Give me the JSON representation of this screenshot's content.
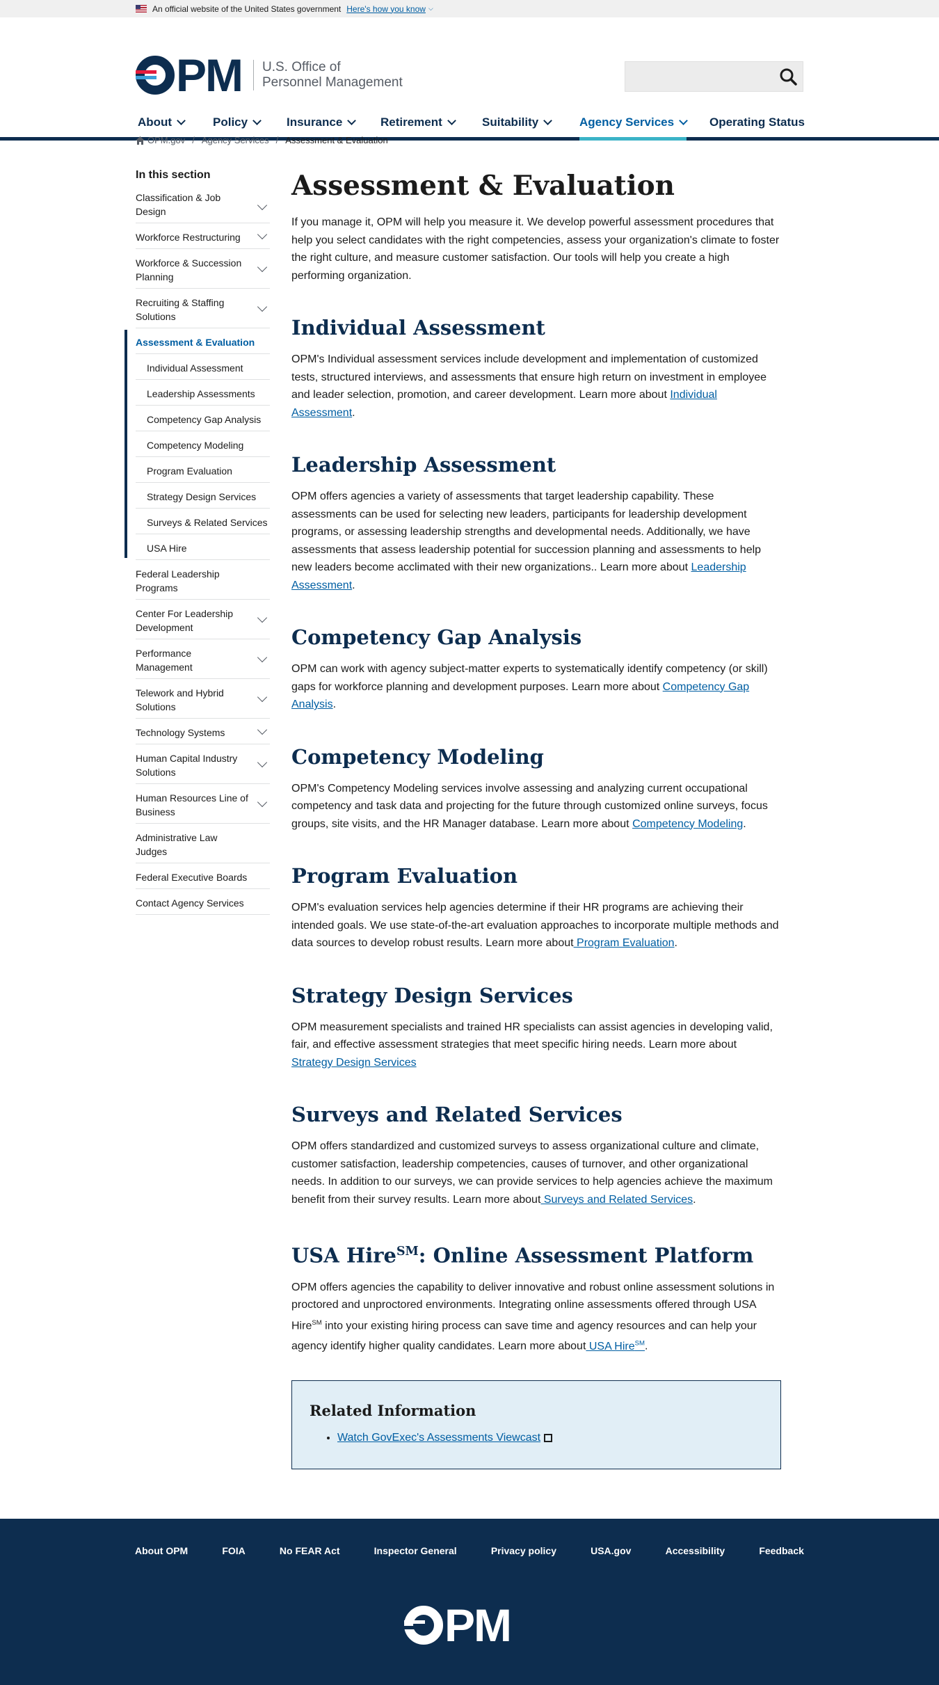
{
  "banner": {
    "text": "An official website of the United States government",
    "link": "Here's how you know"
  },
  "logo": {
    "mark": "PM",
    "line1": "U.S. Office of",
    "line2": "Personnel Management"
  },
  "search": {
    "placeholder": ""
  },
  "nav": [
    {
      "label": "About"
    },
    {
      "label": "Policy"
    },
    {
      "label": "Insurance"
    },
    {
      "label": "Retirement"
    },
    {
      "label": "Suitability"
    },
    {
      "label": "Agency Services"
    },
    {
      "label": "Operating Status"
    }
  ],
  "breadcrumb": {
    "home": "OPM.gov",
    "section": "Agency Services",
    "current": "Assessment & Evaluation",
    "sep": "/"
  },
  "sidenav": {
    "heading": "In this section",
    "items_before": [
      "Classification & Job Design",
      "Workforce Restructuring",
      "Workforce & Succession Planning",
      "Recruiting & Staffing Solutions"
    ],
    "active": "Assessment & Evaluation",
    "sub": [
      "Individual Assessment",
      "Leadership Assessments",
      "Competency Gap Analysis",
      "Competency Modeling",
      "Program Evaluation",
      "Strategy Design Services",
      "Surveys & Related Services",
      "USA Hire"
    ],
    "items_after": [
      "Federal Leadership Programs",
      "Center For Leadership Development",
      "Performance Management",
      "Telework and Hybrid Solutions",
      "Technology Systems",
      "Human Capital Industry Solutions",
      "Human Resources Line of Business",
      "Administrative Law Judges",
      "Federal Executive Boards",
      "Contact Agency Services"
    ]
  },
  "main": {
    "title": "Assessment & Evaluation",
    "intro": "If you manage it, OPM will help you measure it. We develop powerful assessment procedures that help you select candidates with the right competencies, assess your organization's climate to foster the right culture, and measure customer satisfaction. Our tools will help you create a high performing organization.",
    "s1": {
      "h": "Individual Assessment",
      "p": "OPM's Individual assessment services include development and implementation of customized tests, structured interviews, and assessments that ensure high return on investment in employee and leader selection, promotion, and career development. Learn more about ",
      "link": "Individual Assessment",
      "end": "."
    },
    "s2": {
      "h": "Leadership Assessment",
      "p": "OPM offers agencies a variety of assessments that target leadership capability. These assessments can be used for selecting new leaders, participants for leadership development programs, or assessing leadership strengths and developmental needs. Additionally, we have assessments that assess leadership potential for succession planning and assessments to help new leaders become acclimated with their new organizations.. Learn more about ",
      "link": "Leadership Assessment",
      "end": "."
    },
    "s3": {
      "h": "Competency Gap Analysis",
      "p": "OPM can work with agency subject-matter experts to systematically identify competency (or skill) gaps for workforce planning and development purposes. Learn more about ",
      "link": "Competency Gap Analysis",
      "end": "."
    },
    "s4": {
      "h": "Competency Modeling",
      "p": "OPM's Competency Modeling services involve assessing and analyzing current occupational competency and task data and projecting for the future through customized online surveys, focus groups, site visits, and the HR Manager database. Learn more about ",
      "link": "Competency Modeling",
      "end": "."
    },
    "s5": {
      "h": "Program Evaluation",
      "p": "OPM's evaluation services help agencies determine if their HR programs are achieving their intended goals.  We use state-of-the-art evaluation approaches to incorporate multiple methods and data sources to develop robust results. Learn more about",
      "link": " Program Evaluation",
      "end": "."
    },
    "s6": {
      "h": "Strategy Design Services",
      "p": "OPM measurement specialists and trained HR specialists can assist agencies in developing valid, fair, and effective assessment strategies that meet specific hiring needs. Learn more about ",
      "link": "Strategy Design Services",
      "end": ""
    },
    "s7": {
      "h": "Surveys and Related Services",
      "p": "OPM offers standardized and customized surveys to assess organizational culture and climate, customer satisfaction, leadership competencies, causes of turnover, and other organizational needs.  In addition to our surveys, we can provide services to help agencies achieve the maximum benefit from their survey results.   Learn more about",
      "link": " Surveys and Related Services",
      "end": "."
    },
    "s8": {
      "h1": "USA Hire",
      "sm": "SM",
      "h2": ": Online Assessment Platform",
      "p1": "OPM offers agencies the capability to deliver innovative and robust online assessment solutions in proctored and unproctored environments.  Integrating online assessments offered through USA Hire",
      "p2": " into your existing hiring process can save time and agency resources and can help your agency identify higher quality candidates.  Learn more about",
      "link": " USA Hire",
      "end": "."
    },
    "related": {
      "title": "Related Information",
      "link": "Watch GovExec's Assessments Viewcast"
    }
  },
  "footer": {
    "links": [
      "About OPM",
      "FOIA",
      "No FEAR Act",
      "Inspector General",
      "Privacy policy",
      "USA.gov",
      "Accessibility",
      "Feedback"
    ],
    "logo": "PM"
  },
  "colors": {
    "navy": "#0d2d4f",
    "link": "#005ea2",
    "accent": "#3bb3c7",
    "related_bg": "#e1eef6"
  }
}
